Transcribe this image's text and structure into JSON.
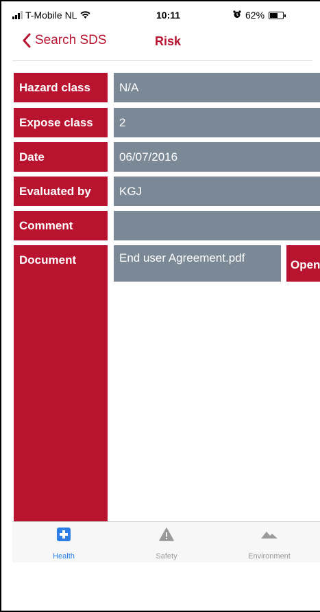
{
  "status_bar": {
    "carrier": "T-Mobile NL",
    "time": "10:11",
    "battery_percent": "62%",
    "battery_level": 0.62
  },
  "nav": {
    "back_label": "Search SDS",
    "title": "Risk"
  },
  "rows": [
    {
      "label": "Hazard class",
      "value": "N/A"
    },
    {
      "label": "Expose class",
      "value": "2"
    },
    {
      "label": "Date",
      "value": "06/07/2016"
    },
    {
      "label": "Evaluated by",
      "value": "KGJ"
    },
    {
      "label": "Comment",
      "value": ""
    }
  ],
  "document": {
    "label": "Document",
    "file_name": "End user Agreement.pdf",
    "open_label": "Open"
  },
  "tabs": [
    {
      "label": "Health",
      "icon": "health-cross-icon",
      "active": true
    },
    {
      "label": "Safety",
      "icon": "warning-triangle-icon",
      "active": false
    },
    {
      "label": "Environment",
      "icon": "mountains-icon",
      "active": false
    }
  ],
  "colors": {
    "accent_red": "#b8132f",
    "value_gray": "#7b8996",
    "tab_active_blue": "#2a7ee6",
    "tab_inactive_gray": "#9a9a9a"
  }
}
